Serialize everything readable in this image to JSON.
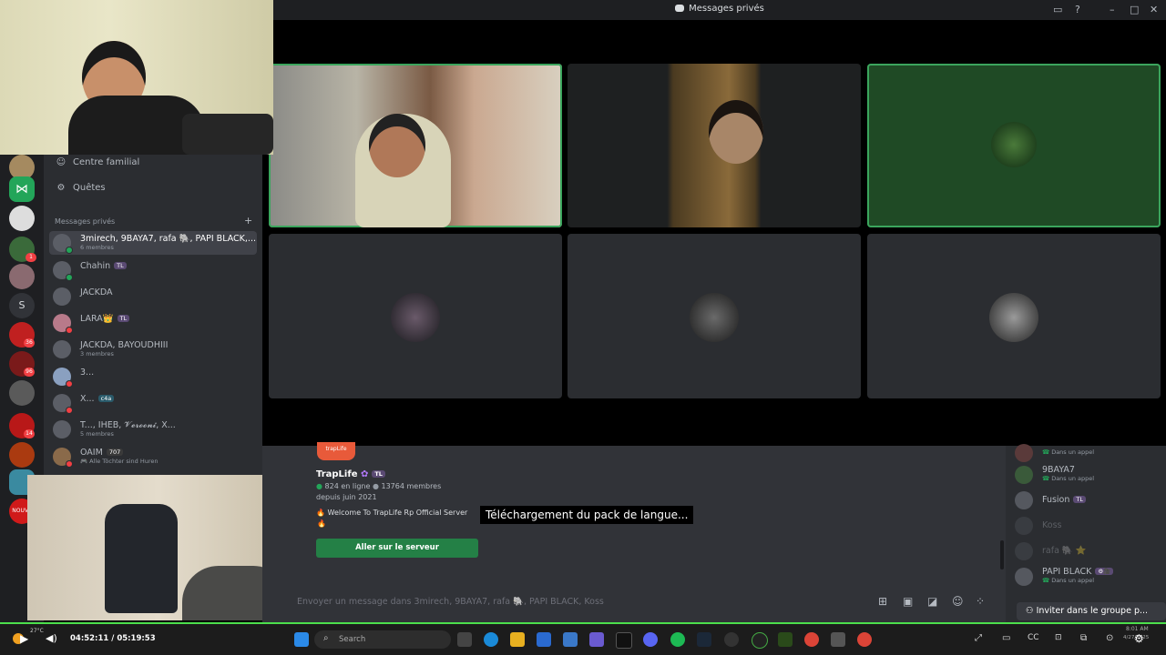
{
  "window": {
    "title": "Messages privés"
  },
  "sidebar": {
    "nav": [
      {
        "label": "Centre familial",
        "icon": "family-icon"
      },
      {
        "label": "Quêtes",
        "icon": "quests-icon"
      }
    ],
    "section_label": "Messages privés",
    "add_icon": "plus-icon",
    "server_badges": [
      "1",
      "36",
      "96",
      "14"
    ],
    "server_letter": "S",
    "server_new": "NOUVE",
    "dms": [
      {
        "name": "3mirech, 9BAYA7, rafa 🐘, PAPI BLACK,...",
        "sub": "6 membres",
        "selected": true
      },
      {
        "name": "Chahin",
        "tag": "TL"
      },
      {
        "name": "JACKDA"
      },
      {
        "name": "LARA👑",
        "tag": "TL"
      },
      {
        "name": "JACKDA, BAYOUDHIII",
        "sub": "3 membres"
      },
      {
        "name": "3..."
      },
      {
        "name": "X...",
        "tag": "c4a"
      },
      {
        "name": "T..., IHEB, 𝓥𝓮𝓻𝓸𝓸𝓷𝓲, X...",
        "sub": "5 membres"
      },
      {
        "name": "OAIM",
        "tag": "707",
        "sub": "🎮 Alle Töchter sind Huren"
      }
    ]
  },
  "chat": {
    "server_card": {
      "logo_text": "trapLife",
      "name": "TrapLife",
      "tag": "TL",
      "online": "824 en ligne",
      "members": "13764 membres",
      "since": "depuis juin 2021",
      "description": "Welcome To TrapLife Rp Official Server",
      "button": "Aller sur le serveur"
    },
    "caption": "Téléchargement du pack de langue...",
    "input_placeholder": "Envoyer un message dans 3mirech, 9BAYA7, rafa 🐘, PAPI BLACK, Koss"
  },
  "members": {
    "list": [
      {
        "name": "",
        "status": "Dans un appel"
      },
      {
        "name": "9BAYA7",
        "status": "Dans un appel"
      },
      {
        "name": "Fusion",
        "tag": "TL"
      },
      {
        "name": "Koss"
      },
      {
        "name": "rafa 🐘 ⭐"
      },
      {
        "name": "PAPI BLACK",
        "tag": "⚙🎥",
        "status": "Dans un appel"
      }
    ],
    "invite_button": "Inviter dans le groupe p..."
  },
  "player": {
    "current": "04:52:11",
    "total": "05:19:53",
    "temp": "27°C"
  },
  "taskbar": {
    "search_placeholder": "Search",
    "time": "8:01 AM",
    "date": "4/27/2025"
  },
  "colors": {
    "accent": "#3ba55d",
    "bg": "#313338",
    "sidebar": "#2b2d31",
    "button": "#248046"
  }
}
